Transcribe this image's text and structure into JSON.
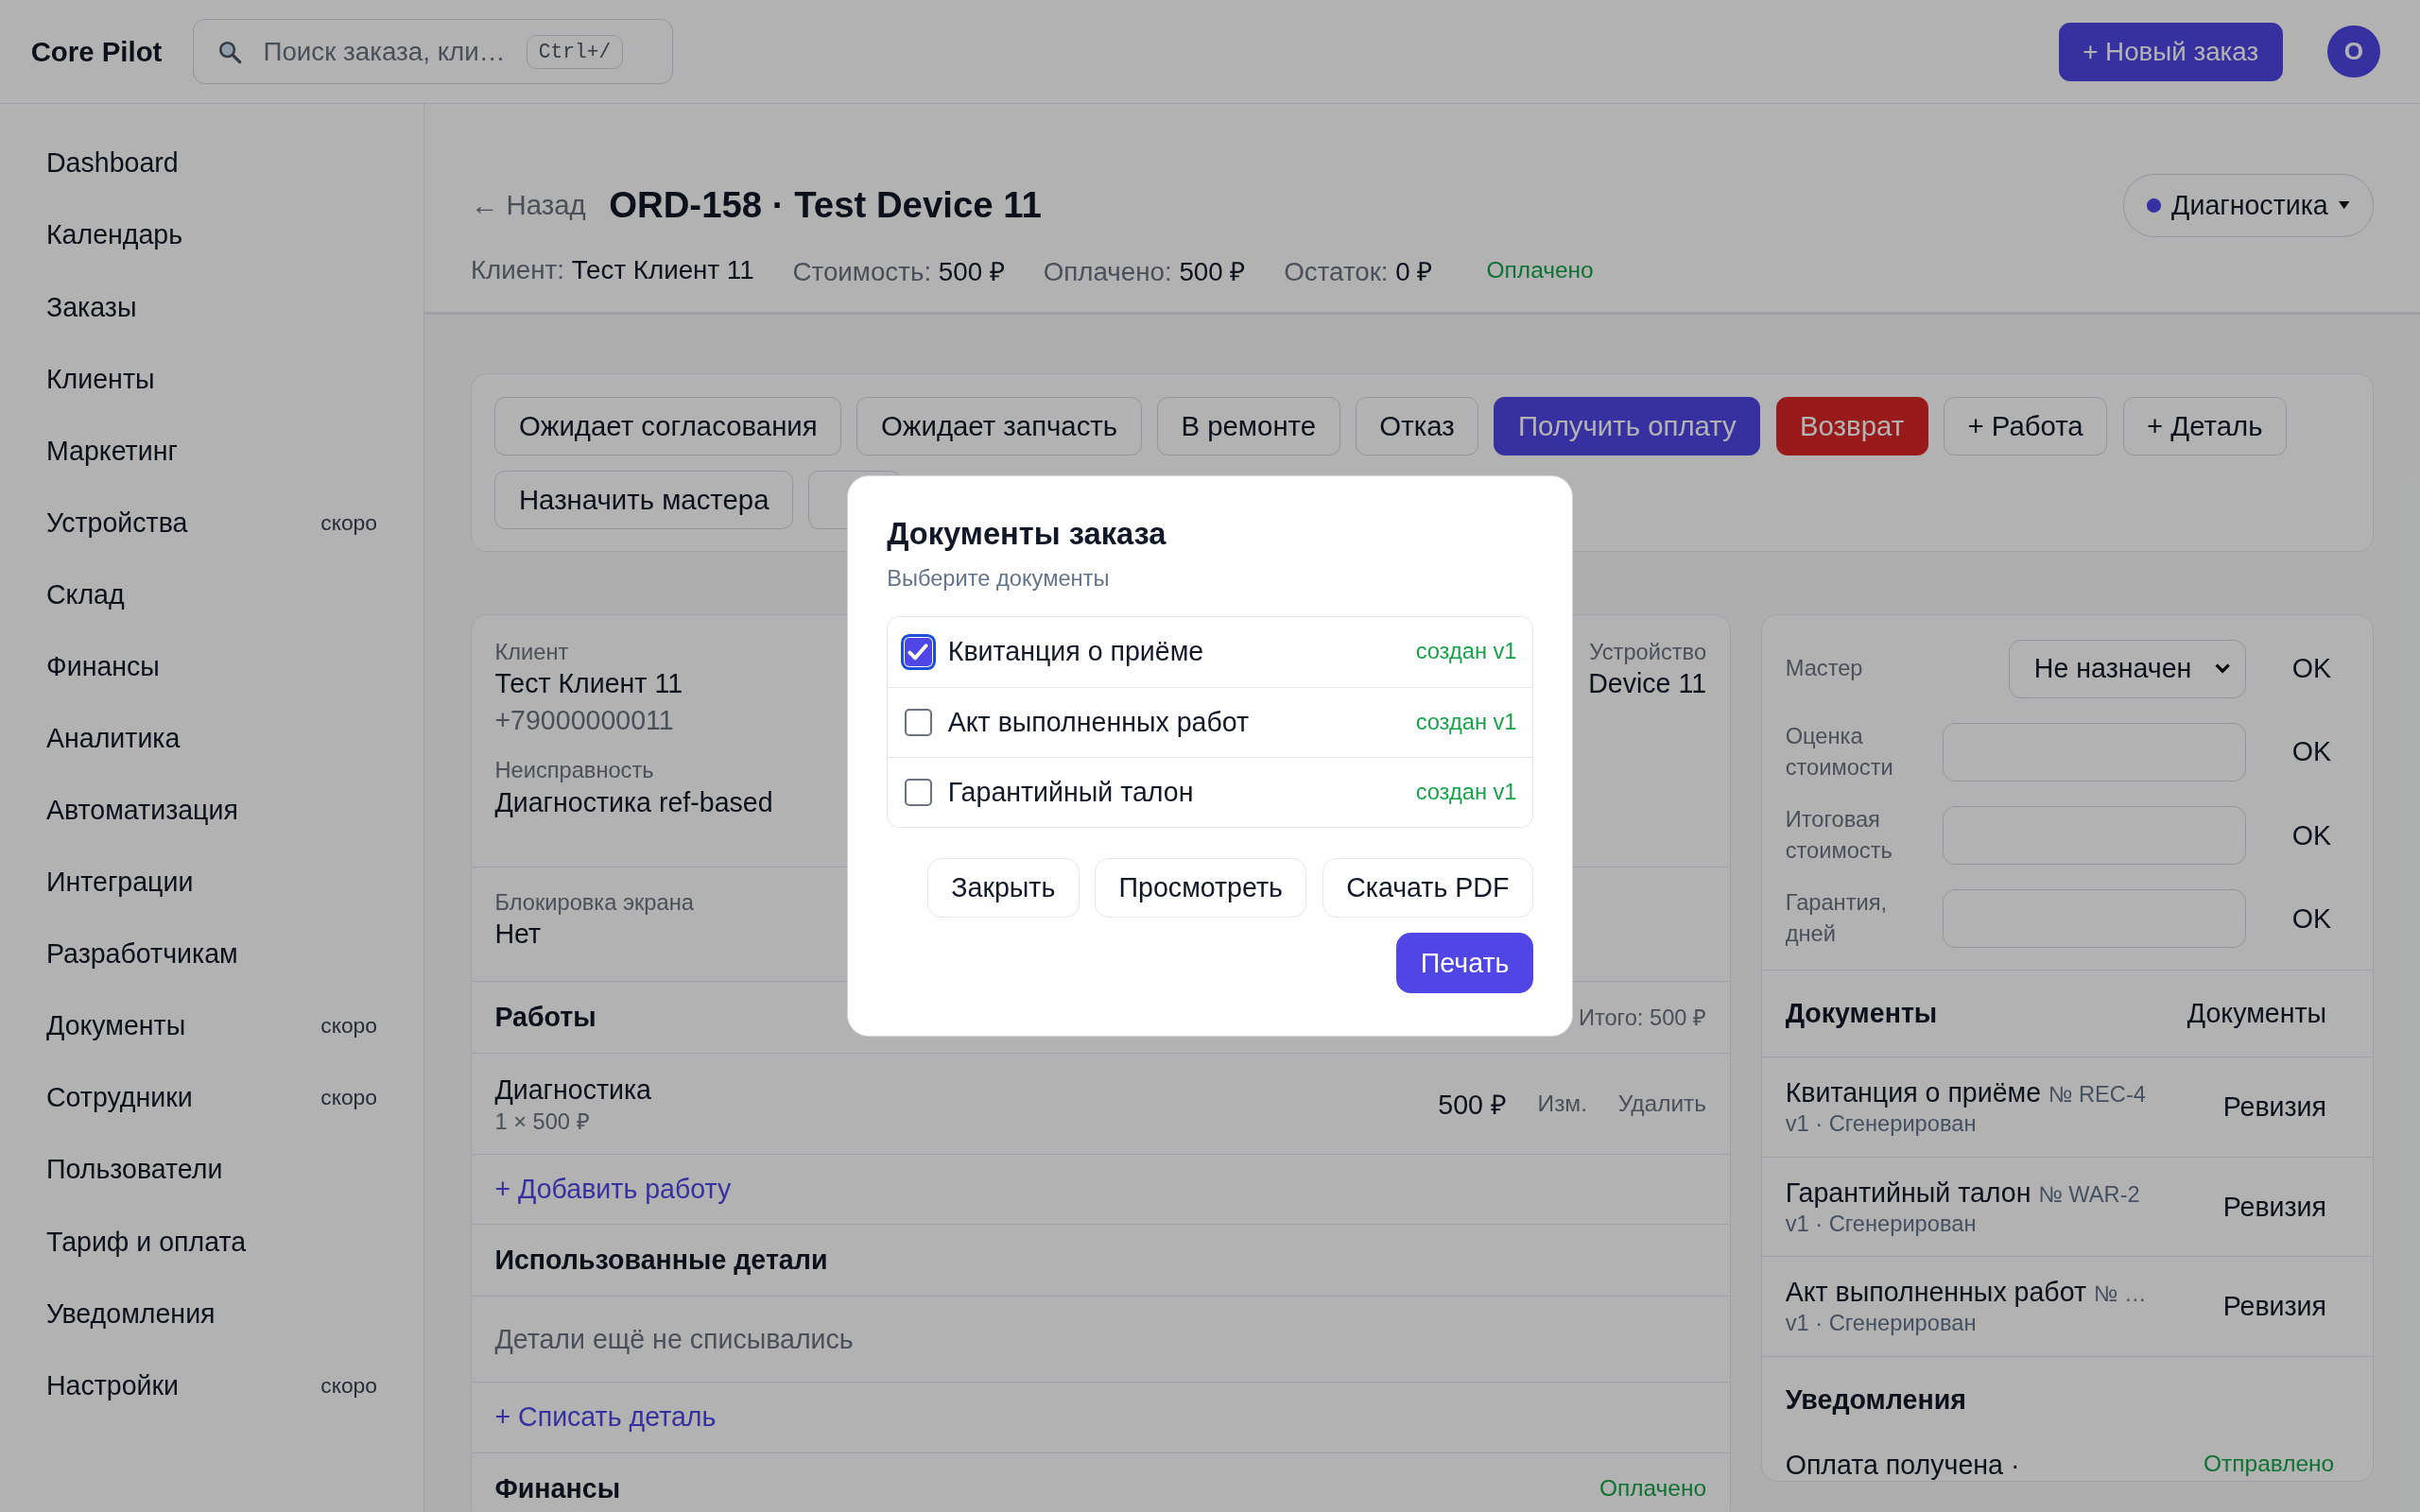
{
  "app": {
    "name": "Core Pilot",
    "new_order": "+ Новый заказ",
    "avatar": "O"
  },
  "search": {
    "placeholder": "Поиск заказа, кли…",
    "shortcut": "Ctrl+/"
  },
  "sidebar": {
    "items": [
      {
        "label": "Dashboard"
      },
      {
        "label": "Календарь"
      },
      {
        "label": "Заказы"
      },
      {
        "label": "Клиенты"
      },
      {
        "label": "Маркетинг"
      },
      {
        "label": "Устройства",
        "badge": "скоро"
      },
      {
        "label": "Склад"
      },
      {
        "label": "Финансы"
      },
      {
        "label": "Аналитика"
      },
      {
        "label": "Автоматизация"
      },
      {
        "label": "Интеграции"
      },
      {
        "label": "Разработчикам"
      },
      {
        "label": "Документы",
        "badge": "скоро"
      },
      {
        "label": "Сотрудники",
        "badge": "скоро"
      },
      {
        "label": "Пользователи"
      },
      {
        "label": "Тариф и оплата"
      },
      {
        "label": "Уведомления"
      },
      {
        "label": "Настройки",
        "badge": "скоро"
      }
    ]
  },
  "order": {
    "back": "← Назад",
    "title": "ORD-158 · Test Device 11",
    "status": "Диагностика",
    "meta": [
      {
        "label": "Клиент:",
        "value": "Тест Клиент 11"
      },
      {
        "label": "Стоимость:",
        "value": "500 ₽"
      },
      {
        "label": "Оплачено:",
        "value": "500 ₽"
      },
      {
        "label": "Остаток:",
        "value": "0 ₽"
      }
    ],
    "payment_status": "Оплачено"
  },
  "actions": [
    {
      "label": "Ожидает согласования",
      "kind": "default"
    },
    {
      "label": "Ожидает запчасть",
      "kind": "default"
    },
    {
      "label": "В ремонте",
      "kind": "default"
    },
    {
      "label": "Отказ",
      "kind": "default"
    },
    {
      "label": "Получить оплату",
      "kind": "primary"
    },
    {
      "label": "Возврат",
      "kind": "danger"
    },
    {
      "label": "+ Работа",
      "kind": "default"
    },
    {
      "label": "+ Деталь",
      "kind": "default"
    },
    {
      "label": "Назначить мастера",
      "kind": "default"
    },
    {
      "kind": "default"
    }
  ],
  "details": {
    "client": {
      "label": "Клиент",
      "name": "Тест Клиент 11",
      "phone": "+79000000011"
    },
    "device": {
      "label": "Устройство",
      "value": "Device 11"
    },
    "problem": {
      "label": "Неисправность",
      "value": "Диагностика ref-based"
    },
    "lock": {
      "label": "Блокировка экрана",
      "value": "Нет"
    },
    "works": {
      "title": "Работы",
      "total": "Итого: 500 ₽",
      "rows": [
        {
          "name": "Диагностика",
          "qty": "1 × 500 ₽",
          "price": "500 ₽",
          "edit": "Изм.",
          "delete": "Удалить"
        }
      ],
      "add": "+ Добавить работу"
    },
    "parts": {
      "title": "Использованные детали",
      "empty": "Детали ещё не списывались",
      "add": "+ Списать деталь"
    },
    "finance": {
      "title": "Финансы",
      "status": "Оплачено"
    }
  },
  "side": {
    "fields": [
      {
        "label": "Мастер",
        "kind": "select",
        "value": "Не назначен",
        "action": "OK"
      },
      {
        "label": "Оценка стоимости",
        "kind": "input",
        "action": "OK"
      },
      {
        "label": "Итоговая стоимость",
        "kind": "input",
        "action": "OK"
      },
      {
        "label": "Гарантия, дней",
        "kind": "input",
        "action": "OK"
      }
    ],
    "documents": {
      "title": "Документы",
      "button": "Документы",
      "items": [
        {
          "name": "Квитанция о приёме",
          "number": "№ REC-4",
          "meta": "v1 · Сгенерирован",
          "action": "Ревизия"
        },
        {
          "name": "Гарантийный талон",
          "number": "№ WAR-2",
          "meta": "v1 · Сгенерирован",
          "action": "Ревизия"
        },
        {
          "name": "Акт выполненных работ",
          "number": "№ …",
          "meta": "v1 · Сгенерирован",
          "action": "Ревизия"
        }
      ]
    },
    "notifications": {
      "title": "Уведомления",
      "items": [
        {
          "text": "Оплата получена ·",
          "status": "Отправлено"
        }
      ]
    }
  },
  "modal": {
    "title": "Документы заказа",
    "subtitle": "Выберите документы",
    "documents": [
      {
        "label": "Квитанция о приёме",
        "status": "создан v1",
        "checked": true
      },
      {
        "label": "Акт выполненных работ",
        "status": "создан v1",
        "checked": false
      },
      {
        "label": "Гарантийный талон",
        "status": "создан v1",
        "checked": false
      }
    ],
    "buttons": [
      {
        "label": "Закрыть",
        "kind": "default"
      },
      {
        "label": "Просмотреть",
        "kind": "default"
      },
      {
        "label": "Скачать PDF",
        "kind": "default"
      },
      {
        "label": "Печать",
        "kind": "primary"
      }
    ]
  }
}
